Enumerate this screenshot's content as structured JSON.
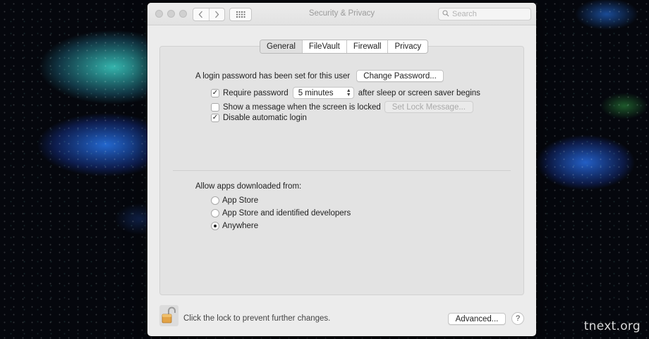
{
  "window": {
    "title": "Security & Privacy",
    "search_placeholder": "Search"
  },
  "tabs": [
    {
      "label": "General",
      "active": true
    },
    {
      "label": "FileVault",
      "active": false
    },
    {
      "label": "Firewall",
      "active": false
    },
    {
      "label": "Privacy",
      "active": false
    }
  ],
  "general": {
    "login_password_text": "A login password has been set for this user",
    "change_password_label": "Change Password...",
    "require_password": {
      "label": "Require password",
      "checked": true
    },
    "require_delay_value": "5 minutes",
    "require_suffix": "after sleep or screen saver begins",
    "show_message": {
      "label": "Show a message when the screen is locked",
      "checked": false
    },
    "set_lock_message_label": "Set Lock Message...",
    "disable_auto_login": {
      "label": "Disable automatic login",
      "checked": true
    }
  },
  "allow_apps": {
    "heading": "Allow apps downloaded from:",
    "options": [
      {
        "label": "App Store",
        "selected": false
      },
      {
        "label": "App Store and identified developers",
        "selected": false
      },
      {
        "label": "Anywhere",
        "selected": true
      }
    ]
  },
  "footer": {
    "lock_text": "Click the lock to prevent further changes.",
    "advanced_label": "Advanced...",
    "help_label": "?"
  },
  "watermark": "tnext.org",
  "icons": {
    "lock": "unlocked-padlock-icon",
    "back": "chevron-left-icon",
    "forward": "chevron-right-icon",
    "grid": "grid-icon",
    "search": "search-icon"
  }
}
